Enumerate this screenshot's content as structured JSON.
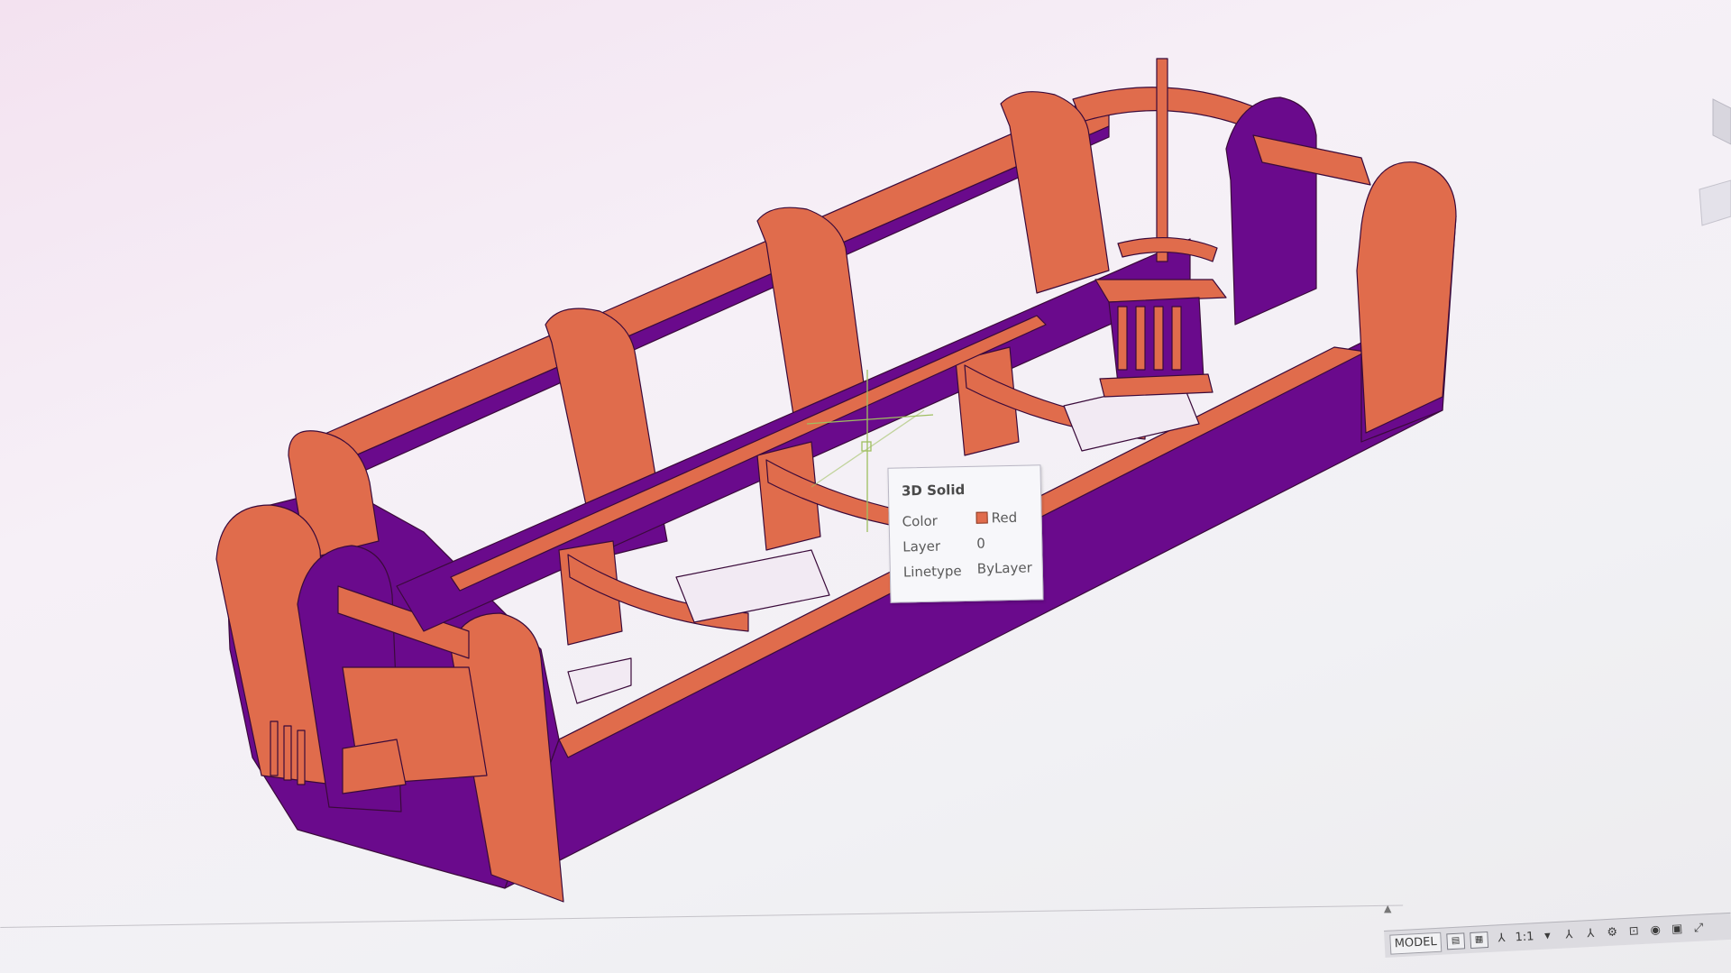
{
  "tooltip": {
    "title": "3D Solid",
    "rows": [
      {
        "label": "Color",
        "value": "Red"
      },
      {
        "label": "Layer",
        "value": "0"
      },
      {
        "label": "Linetype",
        "value": "ByLayer"
      }
    ],
    "swatch_color": "#e06c4c"
  },
  "statusbar": {
    "model_label": "MODEL",
    "scale_label": "1:1"
  },
  "colors": {
    "solid_face": "#e06c4c",
    "solid_shadow": "#6a0a8c",
    "solid_edge": "#3a0a3a",
    "crosshair": "#9fbf60"
  },
  "icons": {
    "paper-layout": "layout-icon",
    "grid": "grid-icon",
    "annotation-scale": "annotation-icon",
    "workspace": "gear-icon",
    "cmd-scroll": "chevron-up-icon"
  }
}
